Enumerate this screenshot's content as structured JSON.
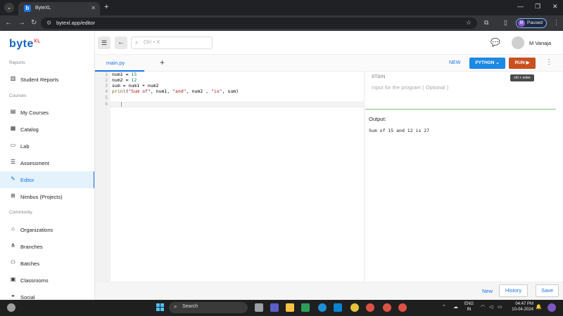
{
  "browser": {
    "tab_title": "ByteXL",
    "tab_favicon": "b",
    "url": "bytexl.app/editor",
    "profile_initial": "M",
    "profile_status": "Paused"
  },
  "app": {
    "logo_text": "byte",
    "logo_sup": "XL",
    "search_placeholder": "Ctrl + K",
    "user_name": "M Vanaja"
  },
  "sidebar": {
    "sections": [
      {
        "label": "Reports"
      },
      {
        "label": "Courses"
      },
      {
        "label": "Community"
      }
    ],
    "items": [
      {
        "label": "Student Reports",
        "icon": "chart-icon"
      },
      {
        "label": "My Courses",
        "icon": "book-icon"
      },
      {
        "label": "Catalog",
        "icon": "catalog-icon"
      },
      {
        "label": "Lab",
        "icon": "laptop-icon"
      },
      {
        "label": "Assessment",
        "icon": "assessment-icon"
      },
      {
        "label": "Editor",
        "icon": "editor-icon",
        "active": true
      },
      {
        "label": "Nimbus (Projects)",
        "icon": "projects-icon"
      },
      {
        "label": "Organizations",
        "icon": "building-icon"
      },
      {
        "label": "Branches",
        "icon": "branches-icon"
      },
      {
        "label": "Batches",
        "icon": "users-icon"
      },
      {
        "label": "Classrooms",
        "icon": "classroom-icon"
      },
      {
        "label": "Social",
        "icon": "social-icon"
      }
    ]
  },
  "editor": {
    "file_tab": "main.py",
    "new_label": "NEW",
    "language": "PYTHON",
    "run_label": "RUN",
    "run_tooltip": "ctrl + enter",
    "line_numbers": [
      "1",
      "2",
      "3",
      "4",
      "5",
      "6"
    ],
    "code": [
      "num1 = 15",
      "num2 = 12",
      "sum = num1 + num2",
      "print(\"Sum of\", num1, \"and\", num2 , \"is\", sum)",
      "",
      ""
    ]
  },
  "io": {
    "stdin_label": "STDIN",
    "stdin_placeholder": "Input for the program ( Optional )",
    "output_label": "Output:",
    "output_text": "Sum of 15 and 12 is 27"
  },
  "footer": {
    "new_label": "New",
    "history_label": "History",
    "save_label": "Save"
  },
  "taskbar": {
    "search_label": "Search",
    "lang_top": "ENG",
    "lang_bottom": "IN",
    "time": "04:47 PM",
    "date": "10-04-2024"
  }
}
